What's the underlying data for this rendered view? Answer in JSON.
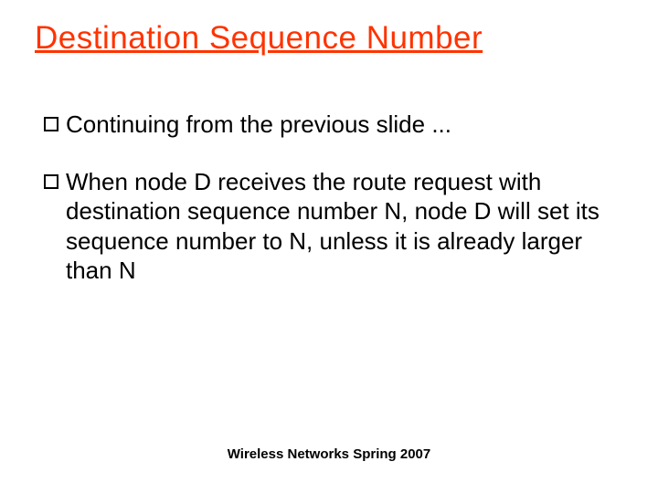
{
  "slide": {
    "title": "Destination Sequence Number",
    "bullets": [
      "Continuing from the previous slide ...",
      "When node D receives the route request with destination sequence number N, node D will set its sequence number to N, unless it is already larger than N"
    ],
    "footer": "Wireless Networks Spring 2007"
  }
}
